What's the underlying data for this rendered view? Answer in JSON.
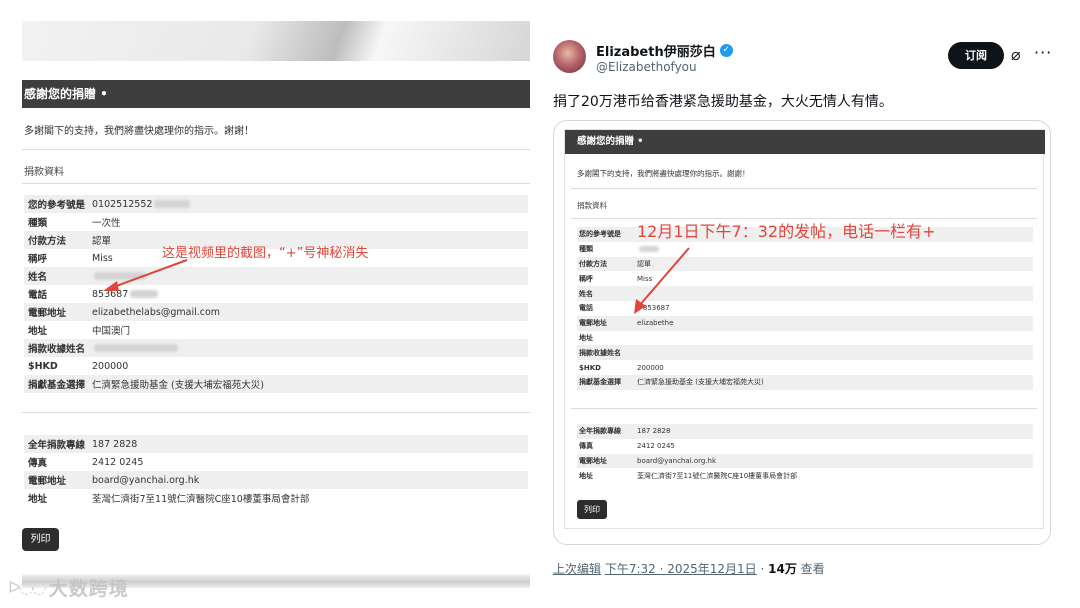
{
  "left": {
    "header": "感謝您的捐贈 •",
    "thanks": "多謝閣下的支持，我們將盡快處理你的指示。謝謝！",
    "section": "捐款資料",
    "rows": [
      {
        "k": "您的參考號是",
        "v": "0102512552"
      },
      {
        "k": "種類",
        "v": "一次性"
      },
      {
        "k": "付款方法",
        "v": "認單"
      },
      {
        "k": "稱呼",
        "v": "Miss"
      },
      {
        "k": "姓名",
        "v": ""
      },
      {
        "k": "電話",
        "v": "853687"
      },
      {
        "k": "電郵地址",
        "v": "elizabethelabs@gmail.com"
      },
      {
        "k": "地址",
        "v": "中国澳门"
      },
      {
        "k": "捐款收據姓名",
        "v": ""
      },
      {
        "k": "$HKD",
        "v": "200000"
      },
      {
        "k": "捐獻基金選擇",
        "v": "仁濟緊急援助基金 (支援大埔宏福苑大災)"
      }
    ],
    "contacts": [
      {
        "k": "全年捐款專線",
        "v": "187 2828"
      },
      {
        "k": "傳真",
        "v": "2412 0245"
      },
      {
        "k": "電郵地址",
        "v": "board@yanchai.org.hk"
      },
      {
        "k": "地址",
        "v": "荃灣仁濟街7至11號仁濟醫院C座10樓董事局會計部"
      }
    ],
    "print": "列印",
    "annotation": "这是视频里的截图，“+”号神秘消失"
  },
  "tweet": {
    "name": "Elizabeth伊丽莎白",
    "handle": "@Elizabethofyou",
    "subscribe": "订阅",
    "text": "捐了20万港币给香港紧急援助基金，大火无情人有情。",
    "meta_edit": "上次编辑",
    "meta_time": "下午7:32 · 2025年12月1日",
    "meta_sep": " · ",
    "meta_views": "14万",
    "meta_views_label": " 查看"
  },
  "card": {
    "header": "感謝您的捐贈 •",
    "thanks": "多謝閣下的支持，我們將盡快處理你的指示。謝謝！",
    "section": "捐款資料",
    "rows": [
      {
        "k": "您的參考號是",
        "v": ""
      },
      {
        "k": "種類",
        "v": ""
      },
      {
        "k": "付款方法",
        "v": "認單"
      },
      {
        "k": "稱呼",
        "v": "Miss"
      },
      {
        "k": "姓名",
        "v": ""
      },
      {
        "k": "電話",
        "v": "+853687"
      },
      {
        "k": "電郵地址",
        "v": "elizabethe"
      },
      {
        "k": "地址",
        "v": ""
      },
      {
        "k": "捐款收據姓名",
        "v": ""
      },
      {
        "k": "$HKD",
        "v": "200000"
      },
      {
        "k": "捐獻基金選擇",
        "v": "仁濟緊急援助基金 (支援大埔宏福苑大災)"
      }
    ],
    "contacts": [
      {
        "k": "全年捐款專線",
        "v": "187 2828"
      },
      {
        "k": "傳真",
        "v": "2412 0245"
      },
      {
        "k": "電郵地址",
        "v": "board@yanchai.org.hk"
      },
      {
        "k": "地址",
        "v": "荃灣仁濟街7至11號仁濟醫院C座10樓董事局會計部"
      }
    ],
    "print": "列印",
    "annotation": "12月1日下午7：32的发帖，电话一栏有+"
  },
  "watermark": "大数跨境",
  "colors": {
    "annotation": "#e0463a",
    "header_bg": "#3e3e3e",
    "verified": "#1d9bf0"
  }
}
